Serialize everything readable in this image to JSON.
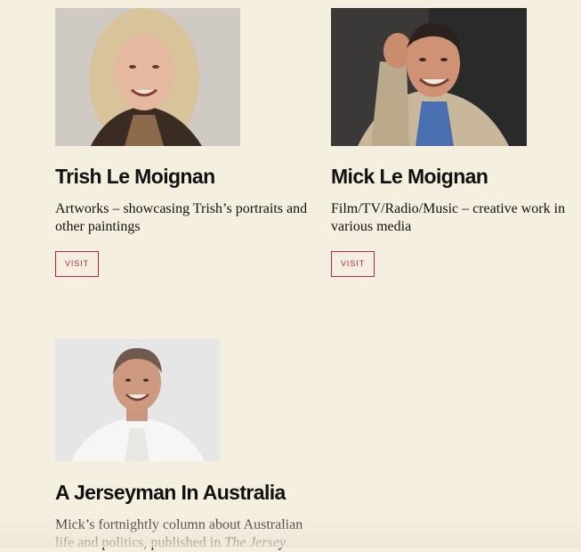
{
  "cards": [
    {
      "photo_alt": "Portrait photo of Trish Le Moignan",
      "title": "Trish Le Moignan",
      "description": "Artworks – showcasing Trish’s portraits and other paintings",
      "button_label": "VISIT"
    },
    {
      "photo_alt": "Portrait photo of Mick Le Moignan",
      "title": "Mick Le Moignan",
      "description": "Film/TV/Radio/Music – creative work in various media",
      "button_label": "VISIT"
    },
    {
      "photo_alt": "Portrait photo for A Jerseyman In Australia",
      "title": "A Jerseyman In Australia",
      "description_prefix": "Mick’s fortnightly column about Australian life and politics, published in ",
      "description_emphasis": "The Jersey"
    }
  ],
  "colors": {
    "background": "#f5efe0",
    "accent": "#c2243c",
    "text": "#111111"
  }
}
